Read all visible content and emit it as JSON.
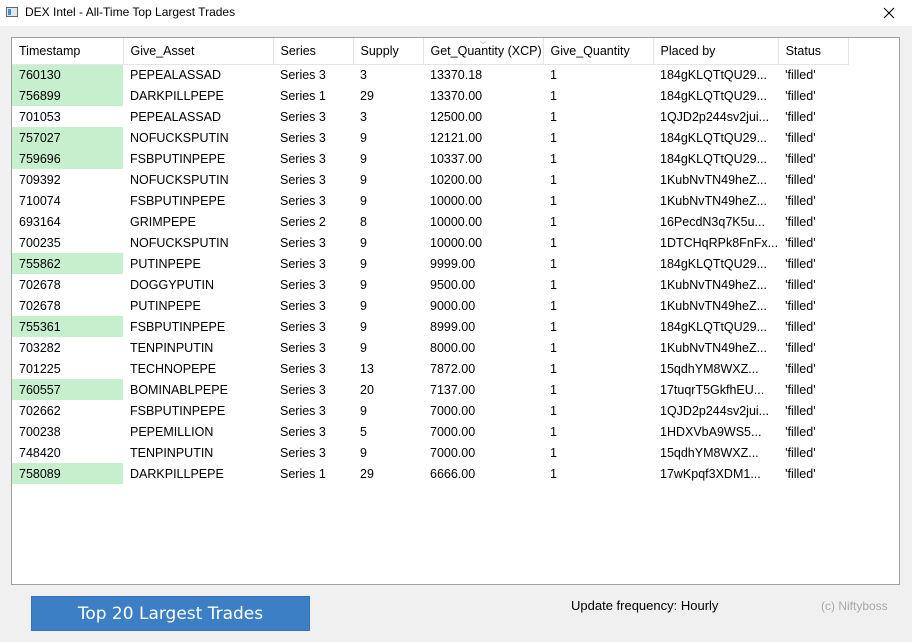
{
  "window": {
    "title": "DEX Intel - All-Time Top Largest Trades"
  },
  "table": {
    "columns": [
      "Timestamp",
      "Give_Asset",
      "Series",
      "Supply",
      "Get_Quantity (XCP)",
      "Give_Quantity",
      "Placed by",
      "Status"
    ],
    "sort_column": "Get_Quantity (XCP)",
    "highlight_color": "#c6efce",
    "rows": [
      {
        "cells": [
          "760130",
          "PEPEALASSAD",
          "Series 3",
          "3",
          "13370.18",
          "1",
          "184gKLQTtQU29...",
          "'filled'"
        ],
        "highlight": true
      },
      {
        "cells": [
          "756899",
          "DARKPILLPEPE",
          "Series 1",
          "29",
          "13370.00",
          "1",
          "184gKLQTtQU29...",
          "'filled'"
        ],
        "highlight": true
      },
      {
        "cells": [
          "701053",
          "PEPEALASSAD",
          "Series 3",
          "3",
          "12500.00",
          "1",
          "1QJD2p244sv2jui...",
          "'filled'"
        ],
        "highlight": false
      },
      {
        "cells": [
          "757027",
          "NOFUCKSPUTIN",
          "Series 3",
          "9",
          "12121.00",
          "1",
          "184gKLQTtQU29...",
          "'filled'"
        ],
        "highlight": true
      },
      {
        "cells": [
          "759696",
          "FSBPUTINPEPE",
          "Series 3",
          "9",
          "10337.00",
          "1",
          "184gKLQTtQU29...",
          "'filled'"
        ],
        "highlight": true
      },
      {
        "cells": [
          "709392",
          "NOFUCKSPUTIN",
          "Series 3",
          "9",
          "10200.00",
          "1",
          "1KubNvTN49heZ...",
          "'filled'"
        ],
        "highlight": false
      },
      {
        "cells": [
          "710074",
          "FSBPUTINPEPE",
          "Series 3",
          "9",
          "10000.00",
          "1",
          "1KubNvTN49heZ...",
          "'filled'"
        ],
        "highlight": false
      },
      {
        "cells": [
          "693164",
          "GRIMPEPE",
          "Series 2",
          "8",
          "10000.00",
          "1",
          "16PecdN3q7K5u...",
          "'filled'"
        ],
        "highlight": false
      },
      {
        "cells": [
          "700235",
          "NOFUCKSPUTIN",
          "Series 3",
          "9",
          "10000.00",
          "1",
          "1DTCHqRPk8FnFx...",
          "'filled'"
        ],
        "highlight": false
      },
      {
        "cells": [
          "755862",
          "PUTINPEPE",
          "Series 3",
          "9",
          "9999.00",
          "1",
          "184gKLQTtQU29...",
          "'filled'"
        ],
        "highlight": true
      },
      {
        "cells": [
          "702678",
          "DOGGYPUTIN",
          "Series 3",
          "9",
          "9500.00",
          "1",
          "1KubNvTN49heZ...",
          "'filled'"
        ],
        "highlight": false
      },
      {
        "cells": [
          "702678",
          "PUTINPEPE",
          "Series 3",
          "9",
          "9000.00",
          "1",
          "1KubNvTN49heZ...",
          "'filled'"
        ],
        "highlight": false
      },
      {
        "cells": [
          "755361",
          "FSBPUTINPEPE",
          "Series 3",
          "9",
          "8999.00",
          "1",
          "184gKLQTtQU29...",
          "'filled'"
        ],
        "highlight": true
      },
      {
        "cells": [
          "703282",
          "TENPINPUTIN",
          "Series 3",
          "9",
          "8000.00",
          "1",
          "1KubNvTN49heZ...",
          "'filled'"
        ],
        "highlight": false
      },
      {
        "cells": [
          "701225",
          "TECHNOPEPE",
          "Series 3",
          "13",
          "7872.00",
          "1",
          "15qdhYM8WXZ...",
          "'filled'"
        ],
        "highlight": false
      },
      {
        "cells": [
          "760557",
          "BOMINABLPEPE",
          "Series 3",
          "20",
          "7137.00",
          "1",
          "17tuqrT5GkfhEU...",
          "'filled'"
        ],
        "highlight": true
      },
      {
        "cells": [
          "702662",
          "FSBPUTINPEPE",
          "Series 3",
          "9",
          "7000.00",
          "1",
          "1QJD2p244sv2jui...",
          "'filled'"
        ],
        "highlight": false
      },
      {
        "cells": [
          "700238",
          "PEPEMILLION",
          "Series 3",
          "5",
          "7000.00",
          "1",
          "1HDXVbA9WS5...",
          "'filled'"
        ],
        "highlight": false
      },
      {
        "cells": [
          "748420",
          "TENPINPUTIN",
          "Series 3",
          "9",
          "7000.00",
          "1",
          "15qdhYM8WXZ...",
          "'filled'"
        ],
        "highlight": false
      },
      {
        "cells": [
          "758089",
          "DARKPILLPEPE",
          "Series 1",
          "29",
          "6666.00",
          "1",
          "17wKpqf3XDM1...",
          "'filled'"
        ],
        "highlight": true
      }
    ]
  },
  "footer": {
    "button_label": "Top 20 Largest Trades",
    "button_color": "#3d7fc4",
    "update_frequency": "Update frequency: Hourly",
    "credit": "(c) Niftyboss"
  }
}
